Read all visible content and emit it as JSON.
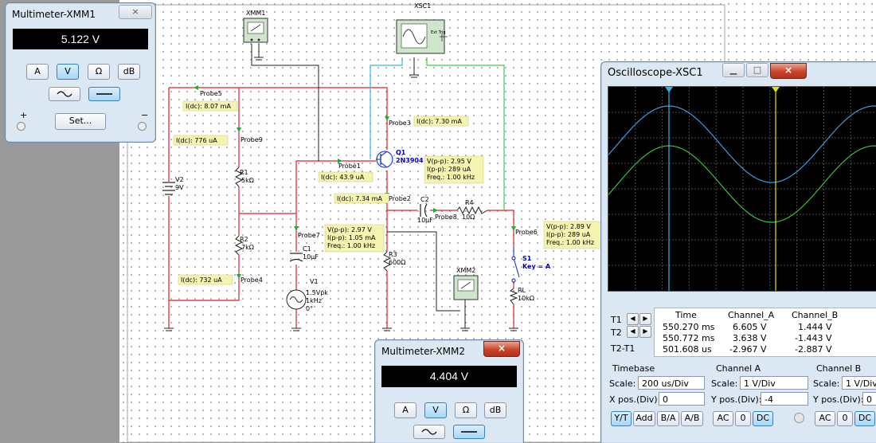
{
  "schematic": {
    "instruments": {
      "xmm1": "XMM1",
      "xmm2": "XMM2",
      "xsc1": "XSC1",
      "ext_trig": "Ext Trig"
    },
    "components": {
      "v2_name": "V2",
      "v2_val": "9V",
      "r1_name": "R1",
      "r1_val": "5kΩ",
      "r2_name": "R2",
      "r2_val": "7kΩ",
      "c1_name": "C1",
      "c1_val": "10µF",
      "v1_name": "V1",
      "v1_val1": "1.5Vpk",
      "v1_val2": "1kHz",
      "v1_val3": "0°",
      "q1_name": "Q1",
      "q1_val": "2N3904",
      "c2_name": "C2",
      "c2_val": "10µF",
      "r4_name": "R4",
      "r4_val": "10Ω",
      "r3_name": "R3",
      "r3_val": "600Ω",
      "s1_name": "S1",
      "s1_key": "Key = A",
      "rl_name": "RL",
      "rl_val": "10kΩ"
    },
    "probes": {
      "probe5": "Probe5",
      "probe9": "Probe9",
      "probe4": "Probe4",
      "probe7": "Probe7",
      "probe1": "Probe1",
      "probe3": "Probe3",
      "probe2": "Probe2",
      "probe8": "Probe8",
      "probe6": "Probe6"
    },
    "notes": {
      "p5": "I(dc): 8.07 mA",
      "p9": "I(dc): 776 uA",
      "p4": "I(dc): 732 uA",
      "p1": "I(dc): 43.9 uA",
      "p3": "I(dc): 7.30 mA",
      "p2": "I(dc): 7.34 mA",
      "q1_vpp": "V(p-p): 2.95 V",
      "q1_ipp": "I(p-p): 289 uA",
      "q1_freq": "Freq.: 1.00 kHz",
      "p7_vpp": "V(p-p): 2.97 V",
      "p7_ipp": "I(p-p): 1.05 mA",
      "p7_freq": "Freq.: 1.00 kHz",
      "p6_vpp": "V(p-p): 2.89 V",
      "p6_ipp": "I(p-p): 289 uA",
      "p6_freq": "Freq.: 1.00 kHz"
    }
  },
  "xmm1": {
    "title": "Multimeter-XMM1",
    "close": "×",
    "reading": "5.122 V",
    "buttons": {
      "a": "A",
      "v": "V",
      "ohm": "Ω",
      "db": "dB"
    },
    "set": "Set...",
    "plus": "+",
    "minus": "−"
  },
  "xmm2": {
    "title": "Multimeter-XMM2",
    "close": "×",
    "reading": "4.404 V",
    "buttons": {
      "a": "A",
      "v": "V",
      "ohm": "Ω",
      "db": "dB"
    }
  },
  "scope": {
    "title": "Oscilloscope-XSC1",
    "t1": "T1",
    "t2": "T2",
    "t2t1": "T2-T1",
    "table": {
      "headers": [
        "Time",
        "Channel_A",
        "Channel_B"
      ],
      "rows": [
        [
          "550.270 ms",
          "6.605 V",
          "1.444 V"
        ],
        [
          "550.772 ms",
          "3.638 V",
          "-1.443 V"
        ],
        [
          "501.608 us",
          "-2.967 V",
          "-2.887 V"
        ]
      ]
    },
    "timebase": {
      "label": "Timebase",
      "scale_label": "Scale:",
      "scale": "200 us/Div",
      "xpos_label": "X pos.(Div):",
      "xpos": "0",
      "modes": [
        "Y/T",
        "Add",
        "B/A",
        "A/B"
      ]
    },
    "channel_a": {
      "label": "Channel A",
      "scale_label": "Scale:",
      "scale": "1  V/Div",
      "ypos_label": "Y pos.(Div):",
      "ypos": "-4",
      "coupling": [
        "AC",
        "0",
        "DC"
      ]
    },
    "channel_b": {
      "label": "Channel B",
      "scale_label": "Scale:",
      "scale": "1  V/Div",
      "ypos_label": "Y pos.(Div):",
      "ypos": "0",
      "coupling": [
        "AC",
        "0",
        "DC"
      ]
    },
    "trace_a_color": "#3d9be0",
    "trace_b_color": "#35c23a",
    "cursor1_color": "#2fb7e8",
    "cursor2_color": "#e4e400"
  }
}
